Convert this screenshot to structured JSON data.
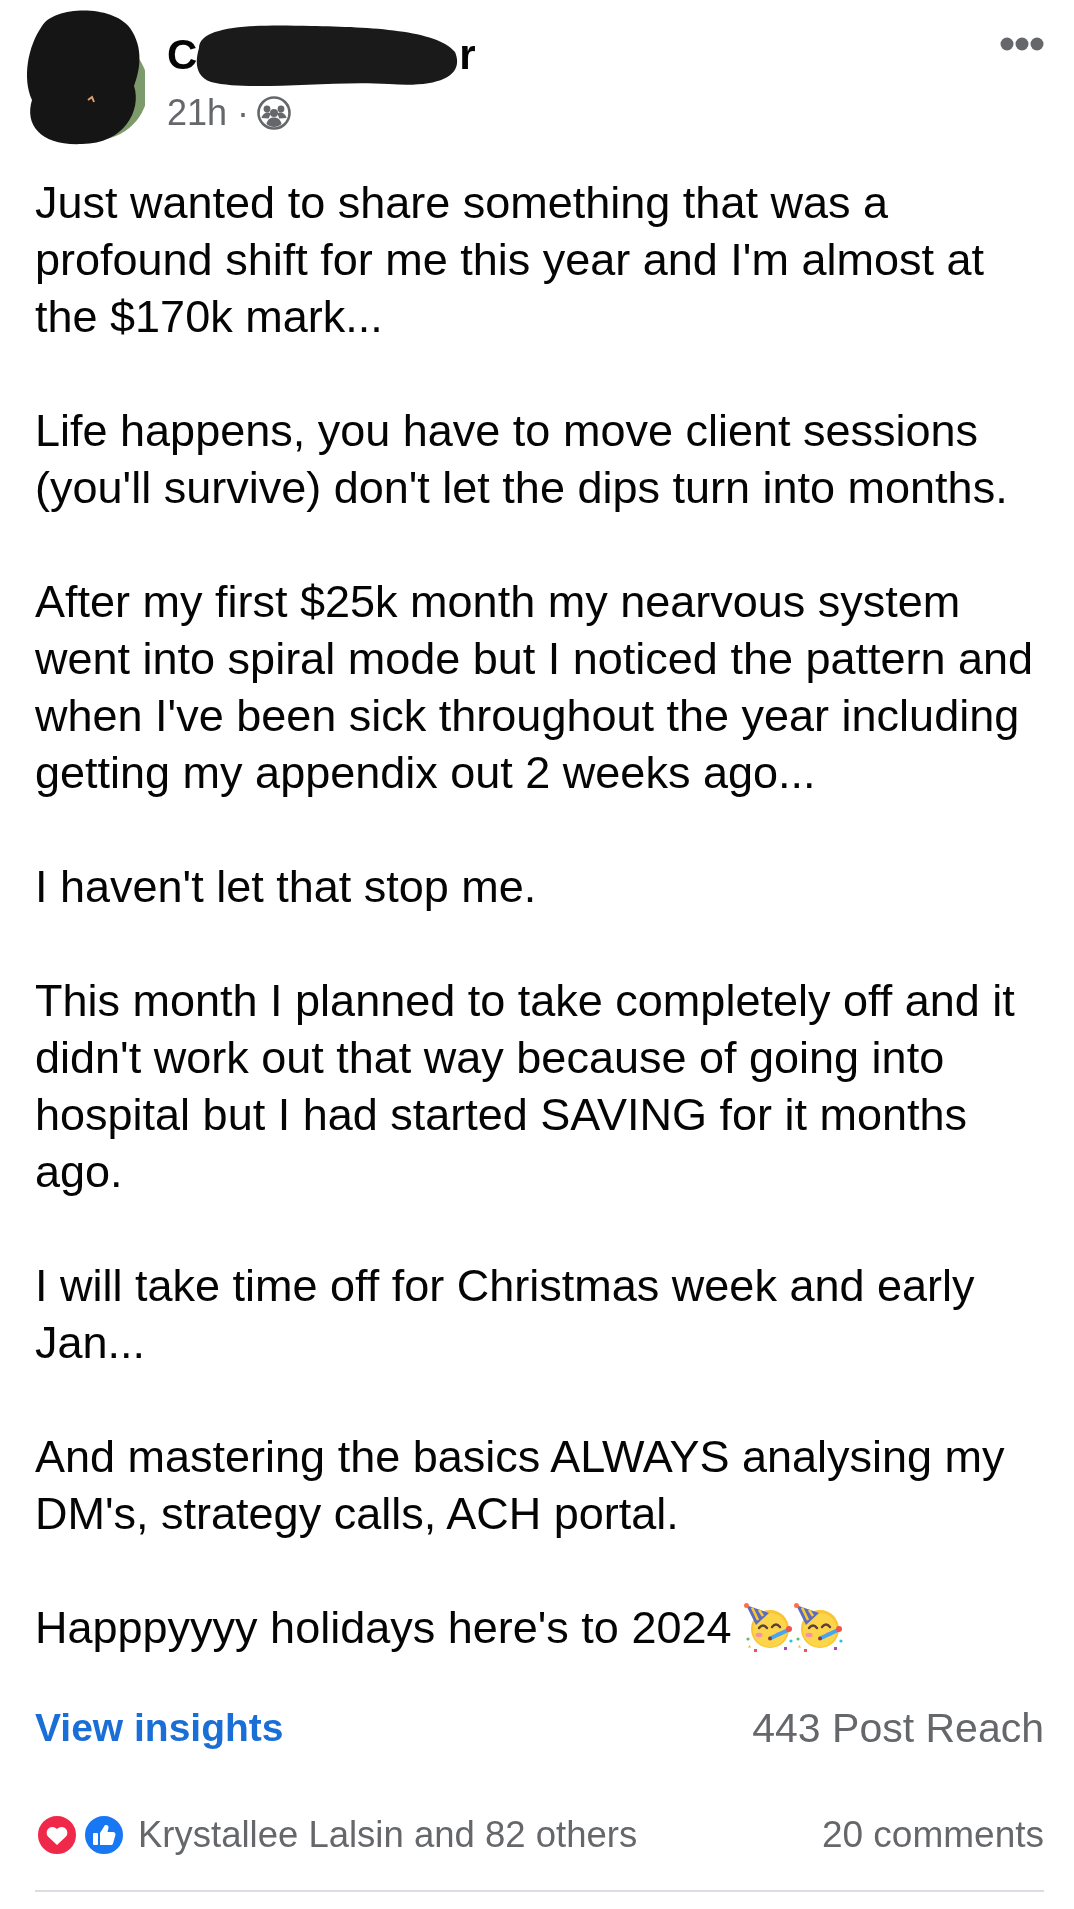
{
  "post": {
    "author": {
      "name_fragments": [
        "C",
        "r"
      ]
    },
    "meta": "21h ·",
    "audience": {
      "kind": "friends"
    },
    "paragraphs": [
      {
        "text": "Just wanted to share something that was a profound shift for me this year and I'm almost at the $170k mark..."
      },
      {
        "text": "Life happens, you have to move client sessions (you'll survive) don't let the dips turn into months."
      },
      {
        "text": "After my first $25k month my nearvous system went into spiral mode but I noticed the pattern and when I've been sick throughout the year including getting my appendix out 2 weeks ago..."
      },
      {
        "text": "I haven't let that stop me."
      },
      {
        "text": "This month I planned to take completely off and it didn't work out that way because of going into hospital but I had started SAVING for it months ago."
      },
      {
        "text": "I will take time off for Christmas week and early Jan..."
      },
      {
        "text": "And mastering the basics ALWAYS analysing my DM's, strategy calls, ACH portal."
      },
      {
        "text": "Happpyyyy holidays here's to 2024",
        "emojis": [
          {
            "kind": "party-face"
          },
          {
            "kind": "party-face"
          }
        ]
      }
    ],
    "insights": {
      "link": "View insights",
      "reach": "443 Post Reach"
    },
    "reactions": {
      "icons": [
        {
          "kind": "love"
        },
        {
          "kind": "like"
        }
      ],
      "summary": "Krystallee Lalsin and 82 others",
      "comments": "20 comments"
    }
  }
}
